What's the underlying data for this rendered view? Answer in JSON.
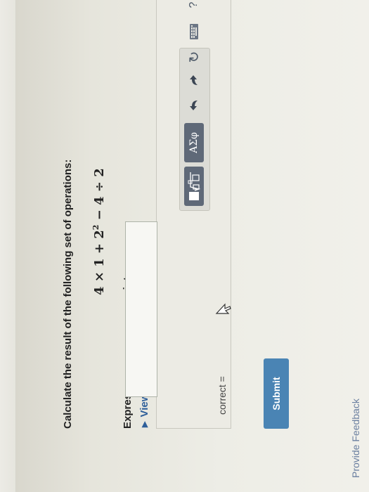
{
  "question": {
    "title": "Calculate the result of the following set of operations:",
    "formula_main": "4 × 1 + 2",
    "formula_exp": "2",
    "formula_rest": " − 4 ÷ 2",
    "instruction": "Express your answer as an integer.",
    "hint_link": "View Available Hint(s)"
  },
  "answer": {
    "label": "correct =",
    "value": "",
    "toolbar": {
      "symbols_label": "ΑΣφ",
      "help_label": "?"
    }
  },
  "actions": {
    "submit_label": "Submit",
    "feedback_link": "Provide Feedback"
  },
  "colors": {
    "submit_bg": "#4a84b4",
    "hint_link": "#2f5f9a",
    "toolbar_button": "#5f6978"
  },
  "icons": [
    "templates-icon",
    "undo-icon",
    "redo-icon",
    "reset-icon",
    "keyboard-icon",
    "help-icon"
  ]
}
